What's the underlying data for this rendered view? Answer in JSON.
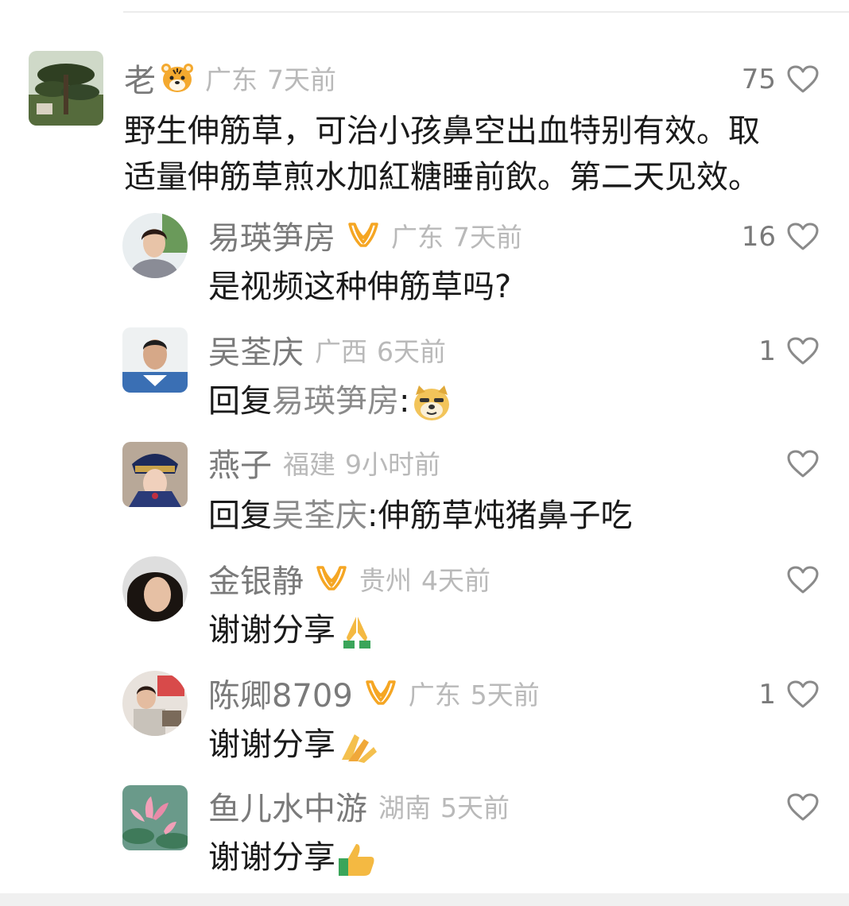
{
  "comments": [
    {
      "name": "老",
      "name_emoji": "tiger-face-emoji",
      "location": "广东",
      "time": "7天前",
      "likes": "75",
      "lines": [
        "野生伸筋草，可治小孩鼻空出血特别有效。取",
        "适量伸筋草煎水加紅糖睡前飲。第二天见效。"
      ]
    },
    {
      "name": "易瑛笋房",
      "badge": "vip-badge",
      "location": "广东",
      "time": "7天前",
      "likes": "16",
      "text": "是视频这种伸筋草吗?"
    },
    {
      "name": "吴荃庆",
      "location": "广西",
      "time": "6天前",
      "likes": "1",
      "reply_prefix": "回复",
      "reply_to": "易瑛笋房",
      "reply_sep": ":",
      "emoji": "doge-emoji"
    },
    {
      "name": "燕子",
      "location": "福建",
      "time": "9小时前",
      "likes": "",
      "reply_prefix": "回复",
      "reply_to": "吴荃庆",
      "reply_sep": ":",
      "text": "伸筋草炖猪鼻子吃"
    },
    {
      "name": "金银静",
      "badge": "vip-badge",
      "location": "贵州",
      "time": "4天前",
      "likes": "",
      "text": "谢谢分享",
      "emoji": "praying-hands-emoji"
    },
    {
      "name": "陈卿8709",
      "badge": "vip-badge",
      "location": "广东",
      "time": "5天前",
      "likes": "1",
      "text": "谢谢分享",
      "emoji": "praying-hands-emoji"
    },
    {
      "name": "鱼儿水中游",
      "location": "湖南",
      "time": "5天前",
      "likes": "",
      "text": "谢谢分享",
      "emoji": "thumbs-up-emoji"
    }
  ],
  "colors": {
    "name": "#7a7a7a",
    "meta": "#b9b9b9",
    "text": "#1a1a1a",
    "badge": "#f5a623"
  }
}
